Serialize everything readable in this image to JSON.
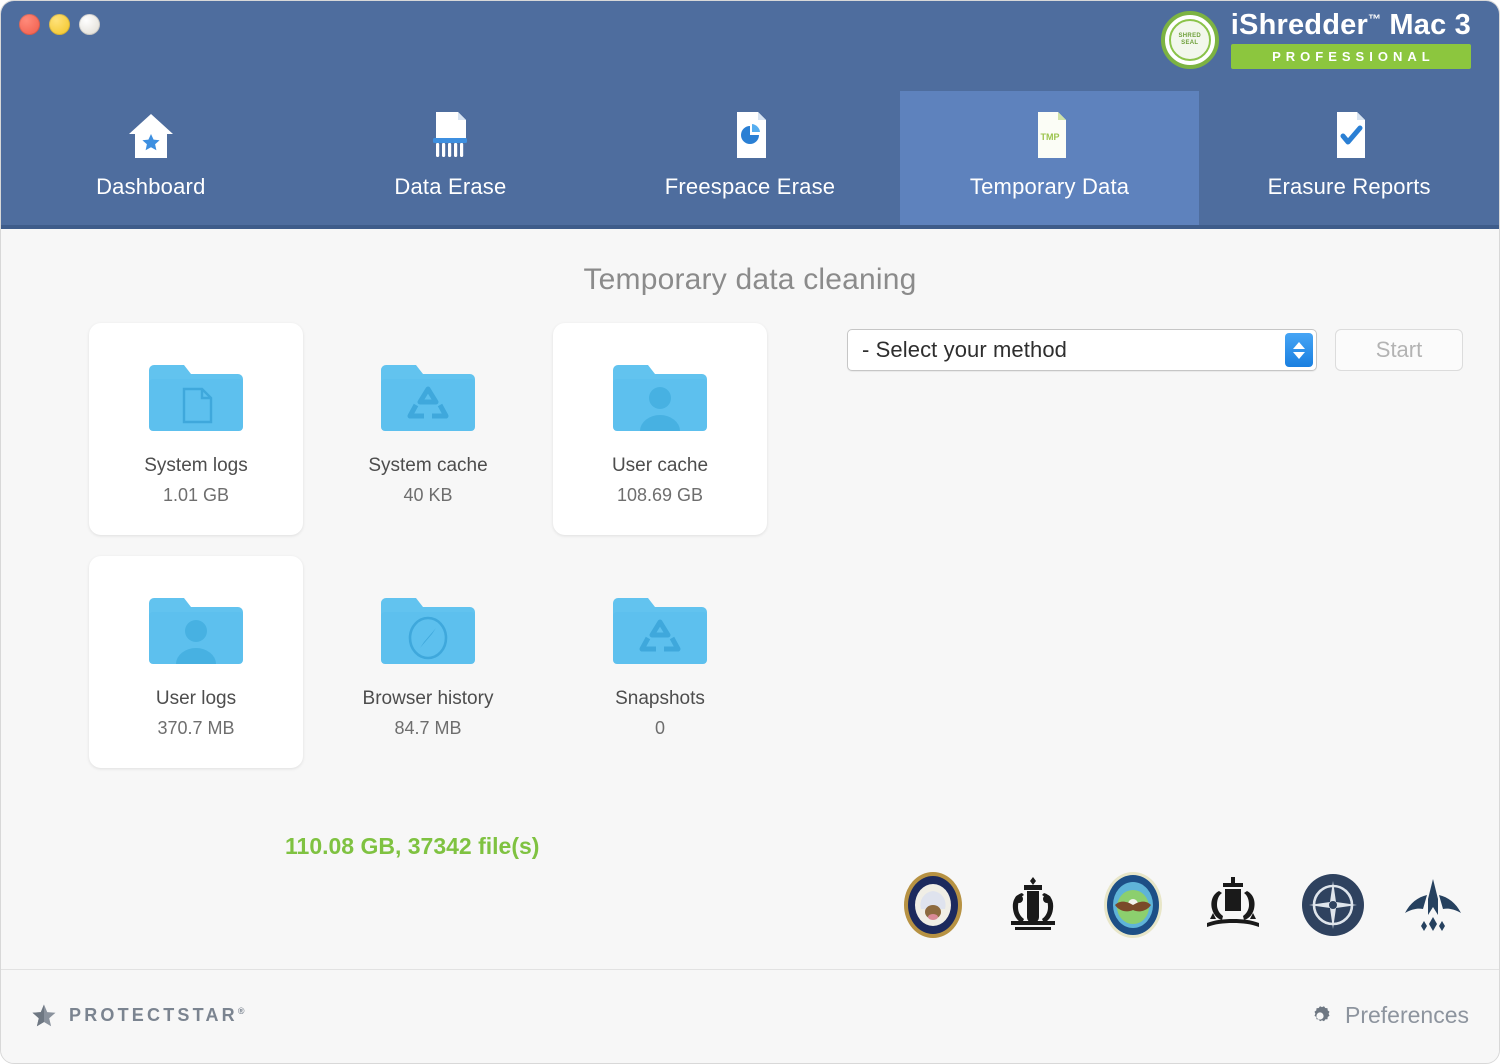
{
  "window": {
    "controls": [
      {
        "name": "close",
        "color": "#f05a48"
      },
      {
        "name": "minimize",
        "color": "#f2c322"
      },
      {
        "name": "zoom",
        "color": "#ddd9d0"
      }
    ],
    "header_color": "#4e6d9e",
    "active_tab_color": "#5e82bd"
  },
  "brand": {
    "seal_text": "SHRED\nSEAL",
    "title": "iShredder",
    "title_tm": "™",
    "title_suffix": " Mac 3",
    "edition": "PROFESSIONAL",
    "edition_color": "#8cc63e"
  },
  "tabs": [
    {
      "label": "Dashboard",
      "icon": "home-star-icon",
      "active": false
    },
    {
      "label": "Data Erase",
      "icon": "shredder-icon",
      "active": false
    },
    {
      "label": "Freespace Erase",
      "icon": "document-piechart-icon",
      "active": false
    },
    {
      "label": "Temporary Data",
      "icon": "tmp-document-icon",
      "active": true
    },
    {
      "label": "Erasure Reports",
      "icon": "document-check-icon",
      "active": false
    }
  ],
  "main": {
    "page_title": "Temporary data cleaning",
    "folders": [
      {
        "name": "System logs",
        "size": "1.01 GB",
        "icon": "folder-document-icon",
        "selected": true
      },
      {
        "name": "System cache",
        "size": "40 KB",
        "icon": "folder-recycle-icon",
        "selected": false
      },
      {
        "name": "User cache",
        "size": "108.69 GB",
        "icon": "folder-user-icon",
        "selected": true
      },
      {
        "name": "User logs",
        "size": "370.7 MB",
        "icon": "folder-user-icon",
        "selected": true
      },
      {
        "name": "Browser history",
        "size": "84.7 MB",
        "icon": "folder-compass-icon",
        "selected": false
      },
      {
        "name": "Snapshots",
        "size": "0",
        "icon": "folder-recycle-icon",
        "selected": false
      }
    ],
    "total_summary": "110.08 GB, 37342 file(s)",
    "total_color": "#7fc241"
  },
  "method": {
    "selected": "- Select your method",
    "options": [
      "- Select your method"
    ],
    "start_label": "Start",
    "start_enabled": false
  },
  "badges": [
    {
      "name": "us-navy-seal"
    },
    {
      "name": "uk-royal-coat-of-arms"
    },
    {
      "name": "us-dod-seal"
    },
    {
      "name": "australian-coat-of-arms"
    },
    {
      "name": "nato-emblem"
    },
    {
      "name": "us-air-force-emblem"
    }
  ],
  "footer": {
    "company": "PROTECTSTAR",
    "company_mark": "®",
    "preferences_label": "Preferences"
  }
}
